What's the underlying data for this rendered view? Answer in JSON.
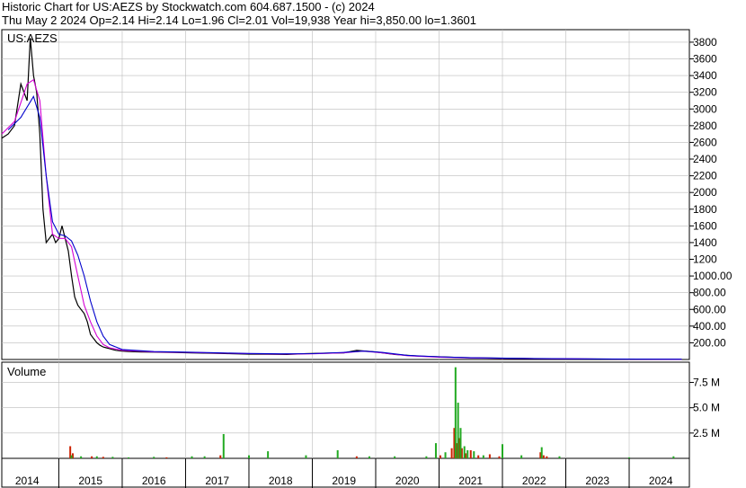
{
  "header": {
    "line1": "Historic Chart for US:AEZS by Stockwatch.com 604.687.1500 - (c) 2024",
    "line2": "Thu May  2 2024  Op=2.14  Hi=2.14  Lo=1.96  Cl=2.01  Vol=19,938  Year hi=3,850.00  lo=1.3601"
  },
  "colors": {
    "price": "#000000",
    "ma_short": "#d400d4",
    "ma_long": "#0000cc",
    "vol_up": "#22aa22",
    "vol_down": "#cc2200",
    "grid": "#bbbbbb"
  },
  "chart_data": [
    {
      "type": "line",
      "title": "US:AEZS",
      "ylim": [
        0,
        3950
      ],
      "y_ticks": [
        "3800",
        "3600",
        "3400",
        "3200",
        "3000",
        "2800",
        "2600",
        "2400",
        "2200",
        "2000",
        "1800",
        "1600",
        "1400",
        "1200",
        "1000.00",
        "800.00",
        "600.00",
        "400.00",
        "200.00"
      ],
      "x_ticks": [
        "2014",
        "2015",
        "2016",
        "2017",
        "2018",
        "2019",
        "2020",
        "2021",
        "2022",
        "2023",
        "2024"
      ],
      "grid": true,
      "series": [
        {
          "key": "price",
          "x": [
            2013.6,
            2013.7,
            2013.8,
            2013.9,
            2014.0,
            2014.05,
            2014.1,
            2014.15,
            2014.2,
            2014.25,
            2014.3,
            2014.35,
            2014.4,
            2014.45,
            2014.5,
            2014.55,
            2014.6,
            2014.65,
            2014.7,
            2014.75,
            2014.8,
            2014.85,
            2014.9,
            2014.95,
            2015.0,
            2015.05,
            2015.1,
            2015.15,
            2015.2,
            2015.25,
            2015.3,
            2015.35,
            2015.4,
            2015.5,
            2015.6,
            2015.8,
            2016.0,
            2016.3,
            2016.6,
            2016.9,
            2017.2,
            2017.5,
            2017.8,
            2018.1,
            2018.4,
            2018.7,
            2019.0,
            2019.2,
            2019.5,
            2019.8,
            2020.2,
            2020.6,
            2020.8,
            2021.0,
            2021.5,
            2022.0,
            2022.5,
            2023.0,
            2023.5,
            2024.33
          ],
          "values": [
            2650,
            2700,
            2800,
            3300,
            3100,
            3850,
            3400,
            3200,
            2700,
            1800,
            1400,
            1450,
            1500,
            1400,
            1450,
            1600,
            1450,
            1300,
            1000,
            750,
            650,
            600,
            550,
            450,
            300,
            250,
            200,
            170,
            150,
            140,
            130,
            120,
            110,
            100,
            95,
            90,
            88,
            85,
            80,
            75,
            70,
            65,
            62,
            60,
            70,
            75,
            80,
            110,
            90,
            60,
            40,
            30,
            25,
            20,
            15,
            10,
            8,
            5,
            3,
            2.01
          ]
        },
        {
          "key": "ma_short",
          "x": [
            2013.6,
            2013.8,
            2014.0,
            2014.1,
            2014.2,
            2014.3,
            2014.4,
            2014.5,
            2014.6,
            2014.7,
            2014.8,
            2014.9,
            2015.0,
            2015.1,
            2015.2,
            2015.3,
            2015.5,
            2016.0,
            2016.5,
            2017.0,
            2017.5,
            2018.0,
            2018.5,
            2019.0,
            2019.3,
            2019.6,
            2020.0,
            2020.5,
            2021.0,
            2022.0,
            2023.0,
            2024.33
          ],
          "values": [
            2700,
            2850,
            3300,
            3350,
            3100,
            2200,
            1500,
            1450,
            1450,
            1350,
            1000,
            650,
            450,
            280,
            180,
            140,
            110,
            90,
            85,
            78,
            70,
            65,
            68,
            80,
            100,
            80,
            45,
            28,
            18,
            10,
            5,
            2
          ]
        },
        {
          "key": "ma_long",
          "x": [
            2013.7,
            2013.9,
            2014.1,
            2014.2,
            2014.3,
            2014.4,
            2014.5,
            2014.6,
            2014.7,
            2014.8,
            2014.9,
            2015.0,
            2015.1,
            2015.2,
            2015.3,
            2015.5,
            2016.0,
            2016.5,
            2017.0,
            2017.5,
            2018.0,
            2018.5,
            2019.0,
            2019.3,
            2019.6,
            2020.0,
            2020.5,
            2021.0,
            2022.0,
            2023.0,
            2024.33
          ],
          "values": [
            2750,
            2900,
            3150,
            2900,
            2200,
            1650,
            1500,
            1480,
            1420,
            1250,
            1000,
            700,
            450,
            280,
            180,
            120,
            95,
            88,
            80,
            72,
            68,
            70,
            85,
            100,
            85,
            50,
            32,
            20,
            12,
            6,
            3
          ]
        }
      ]
    },
    {
      "type": "bar",
      "title": "Volume",
      "ylim": [
        0,
        9.5
      ],
      "y_ticks": [
        "7.5 M",
        "5.0 M",
        "2.5 M"
      ],
      "grid": true,
      "series": [
        {
          "key": "vol_down",
          "x": [
            2014.68,
            2014.72,
            2015.02,
            2015.2,
            2016.2,
            2017.05,
            2019.2,
            2020.45,
            2020.52,
            2020.7,
            2020.74,
            2020.78,
            2020.82,
            2020.86,
            2020.92,
            2021.0,
            2021.12,
            2021.3,
            2021.45,
            2022.1,
            2022.15,
            2022.2
          ],
          "values": [
            1.2,
            0.5,
            0.2,
            0.15,
            0.1,
            0.3,
            0.2,
            0.4,
            0.3,
            1.0,
            3.0,
            1.5,
            2.0,
            1.0,
            0.5,
            0.8,
            0.3,
            0.4,
            0.2,
            0.6,
            0.3,
            0.2
          ]
        },
        {
          "key": "vol_up",
          "x": [
            2014.7,
            2014.85,
            2015.1,
            2015.35,
            2015.6,
            2016.0,
            2016.6,
            2016.8,
            2017.1,
            2017.5,
            2017.8,
            2018.4,
            2018.9,
            2019.4,
            2019.8,
            2020.3,
            2020.45,
            2020.6,
            2020.76,
            2020.8,
            2020.84,
            2020.9,
            2020.95,
            2021.05,
            2021.2,
            2021.5,
            2021.8,
            2022.12,
            2022.4,
            2023.5,
            2024.2
          ],
          "values": [
            0.3,
            0.2,
            0.2,
            0.15,
            0.1,
            0.15,
            0.2,
            0.2,
            2.4,
            0.3,
            0.7,
            0.3,
            0.8,
            0.2,
            0.2,
            0.2,
            1.5,
            0.6,
            9.0,
            5.5,
            3.0,
            1.2,
            0.8,
            0.7,
            0.3,
            1.4,
            0.3,
            1.1,
            0.2,
            0.1,
            0.2
          ]
        }
      ]
    }
  ]
}
